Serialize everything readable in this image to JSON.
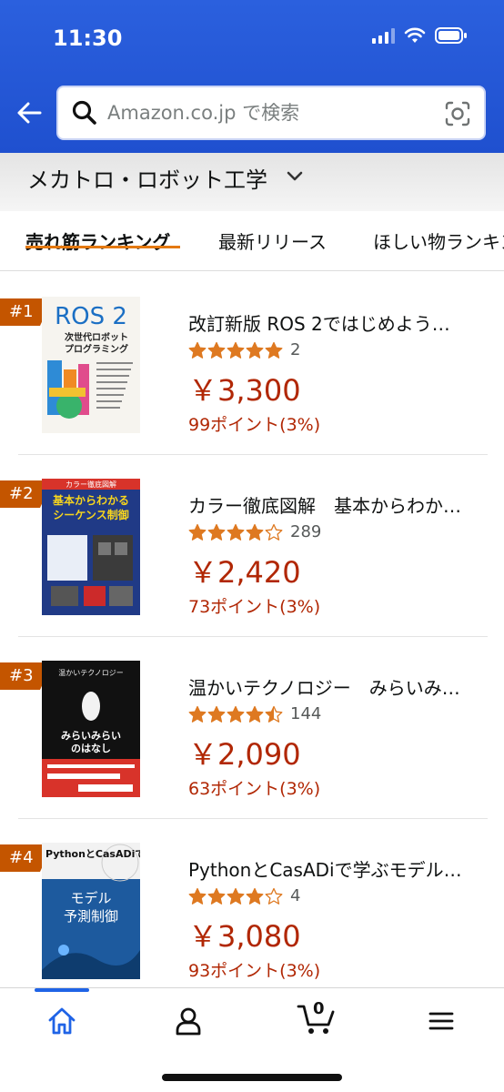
{
  "status_bar": {
    "time": "11:30"
  },
  "search": {
    "placeholder": "Amazon.co.jp で検索"
  },
  "category": {
    "title": "メカトロ・ロボット工学"
  },
  "tabs": [
    {
      "label": "売れ筋ランキング",
      "active": true
    },
    {
      "label": "最新リリース",
      "active": false
    },
    {
      "label": "ほしい物ランキング",
      "active": false
    }
  ],
  "items": [
    {
      "rank": "#1",
      "title": "改訂新版 ROS 2ではじめよう…",
      "rating": 5,
      "rating_count": "2",
      "price": "￥3,300",
      "points": "99ポイント(3%)",
      "cover": {
        "line1": "ROS 2",
        "line2": "次世代ロボット",
        "line3": "プログラミング",
        "bg": "#f6f4ef",
        "accent": "#1b6fc4"
      }
    },
    {
      "rank": "#2",
      "title": "カラー徹底図解　基本からわか…",
      "rating": 4,
      "rating_count": "289",
      "price": "￥2,420",
      "points": "73ポイント(3%)",
      "cover": {
        "line1": "カラー徹底図解",
        "line2": "基本からわかる",
        "line3": "シーケンス制御",
        "bg": "#203a86",
        "accent": "#f7d51d"
      }
    },
    {
      "rank": "#3",
      "title": "温かいテクノロジー　みらいみ…",
      "rating": 4.5,
      "rating_count": "144",
      "price": "￥2,090",
      "points": "63ポイント(3%)",
      "cover": {
        "line1": "温かいテクノロジー",
        "line2": "みらいみらい",
        "line3": "のはなし",
        "bg": "#111111",
        "accent": "#d8332a"
      }
    },
    {
      "rank": "#4",
      "title": "PythonとCasADiで学ぶモデル…",
      "rating": 4,
      "rating_count": "4",
      "price": "￥3,080",
      "points": "93ポイント(3%)",
      "cover": {
        "line1": "PythonとCasADiで学ぶ",
        "line2": "モデル",
        "line3": "予測制御",
        "bg": "#1d5a9e",
        "accent": "#ffffff"
      }
    }
  ],
  "bottom_nav": {
    "cart_count": "0"
  },
  "colors": {
    "header": "#1f50cf",
    "price": "#b12704",
    "star": "#de7921",
    "badge": "#c45500",
    "tab_underline": "#e47911"
  }
}
